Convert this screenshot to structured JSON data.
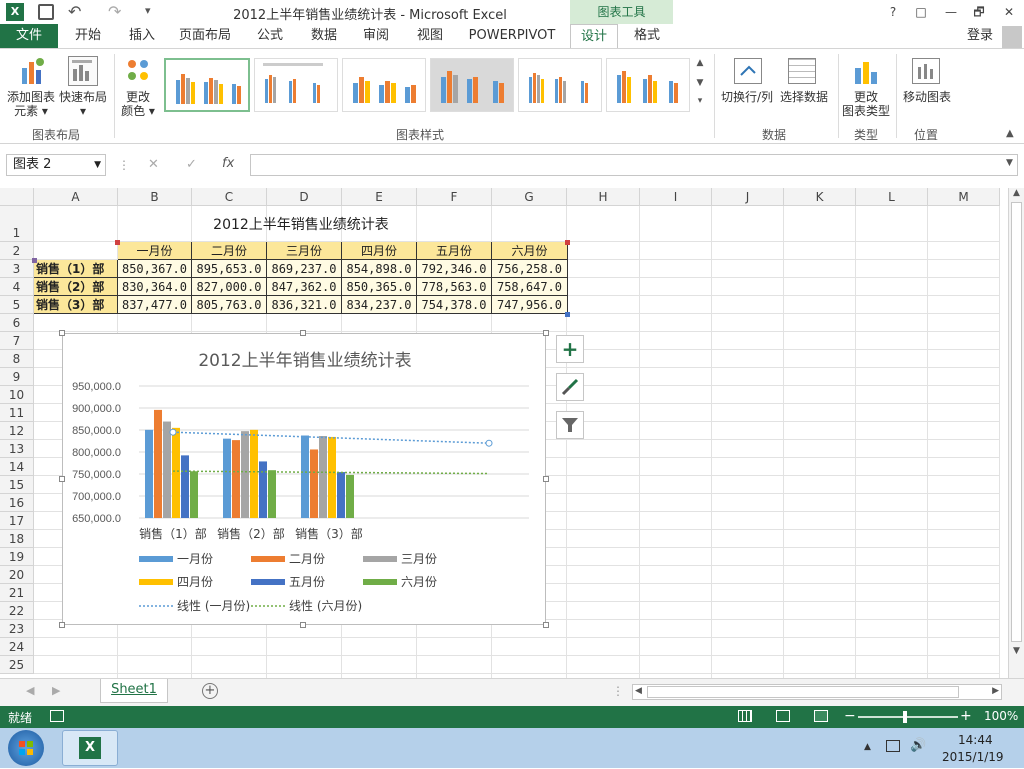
{
  "window": {
    "title": "2012上半年销售业绩统计表 - Microsoft Excel",
    "chart_tools_tab": "图表工具",
    "help": "?",
    "restore": "□",
    "minimize": "—",
    "maximize": "🗗",
    "close": "✕"
  },
  "tabs": {
    "file": "文件",
    "items": [
      "开始",
      "插入",
      "页面布局",
      "公式",
      "数据",
      "审阅",
      "视图",
      "POWERPIVOT",
      "设计",
      "格式"
    ],
    "login": "登录"
  },
  "ribbon": {
    "add_element": "添加图表\n元素▾",
    "add_element_l1": "添加图表",
    "add_element_l2": "元素 ▾",
    "quick_layout_l1": "快速布局",
    "quick_layout_l2": "▾",
    "change_color_l1": "更改",
    "change_color_l2": "颜色 ▾",
    "group_layout": "图表布局",
    "group_styles": "图表样式",
    "switch_row_col": "切换行/列",
    "select_data": "选择数据",
    "group_data": "数据",
    "change_type_l1": "更改",
    "change_type_l2": "图表类型",
    "group_type": "类型",
    "move_chart": "移动图表",
    "group_location": "位置"
  },
  "formula_bar": {
    "name_box": "图表 2",
    "cancel": "✕",
    "enter": "✓",
    "fx": "fx",
    "value": ""
  },
  "sheet": {
    "columns": [
      "A",
      "B",
      "C",
      "D",
      "E",
      "F",
      "G",
      "H",
      "I",
      "J",
      "K",
      "L",
      "M"
    ],
    "rows": [
      "1",
      "2",
      "3",
      "4",
      "5",
      "6",
      "7",
      "8",
      "9",
      "10",
      "11",
      "12",
      "13",
      "14",
      "15",
      "16",
      "17",
      "18",
      "19",
      "20",
      "21",
      "22",
      "23",
      "24",
      "25"
    ],
    "table_title": "2012上半年销售业绩统计表",
    "headers": [
      "一月份",
      "二月份",
      "三月份",
      "四月份",
      "五月份",
      "六月份"
    ],
    "data_rows": [
      {
        "label": "销售（1）部",
        "values": [
          "850,367.0",
          "895,653.0",
          "869,237.0",
          "854,898.0",
          "792,346.0",
          "756,258.0"
        ]
      },
      {
        "label": "销售（2）部",
        "values": [
          "830,364.0",
          "827,000.0",
          "847,362.0",
          "850,365.0",
          "778,563.0",
          "758,647.0"
        ]
      },
      {
        "label": "销售（3）部",
        "values": [
          "837,477.0",
          "805,763.0",
          "836,321.0",
          "834,237.0",
          "754,378.0",
          "747,956.0"
        ]
      }
    ]
  },
  "chart_data": {
    "type": "bar",
    "title": "2012上半年销售业绩统计表",
    "categories": [
      "销售（1）部",
      "销售（2）部",
      "销售（3）部"
    ],
    "series": [
      {
        "name": "一月份",
        "color": "#5b9bd5",
        "values": [
          850367.0,
          830364.0,
          837477.0
        ]
      },
      {
        "name": "二月份",
        "color": "#ed7d31",
        "values": [
          895653.0,
          827000.0,
          805763.0
        ]
      },
      {
        "name": "三月份",
        "color": "#a5a5a5",
        "values": [
          869237.0,
          847362.0,
          836321.0
        ]
      },
      {
        "name": "四月份",
        "color": "#ffc000",
        "values": [
          854898.0,
          850365.0,
          834237.0
        ]
      },
      {
        "name": "五月份",
        "color": "#4472c4",
        "values": [
          792346.0,
          778563.0,
          754378.0
        ]
      },
      {
        "name": "六月份",
        "color": "#70ad47",
        "values": [
          756258.0,
          758647.0,
          747956.0
        ]
      }
    ],
    "trendlines": [
      {
        "name": "线性 (一月份)",
        "color": "#5b9bd5",
        "start": 845000,
        "end": 820000
      },
      {
        "name": "线性 (六月份)",
        "color": "#70ad47",
        "start": 756500,
        "end": 751000
      }
    ],
    "y_ticks": [
      "950,000.0",
      "900,000.0",
      "850,000.0",
      "800,000.0",
      "750,000.0",
      "700,000.0",
      "650,000.0"
    ],
    "ylim": [
      650000,
      950000
    ],
    "grid": true,
    "legend": "bottom"
  },
  "sheet_tabs": {
    "active": "Sheet1",
    "add": "+"
  },
  "status": {
    "ready": "就绪",
    "zoom": "100%",
    "zoom_minus": "−",
    "zoom_plus": "+"
  },
  "taskbar": {
    "time": "14:44",
    "date": "2015/1/19"
  }
}
